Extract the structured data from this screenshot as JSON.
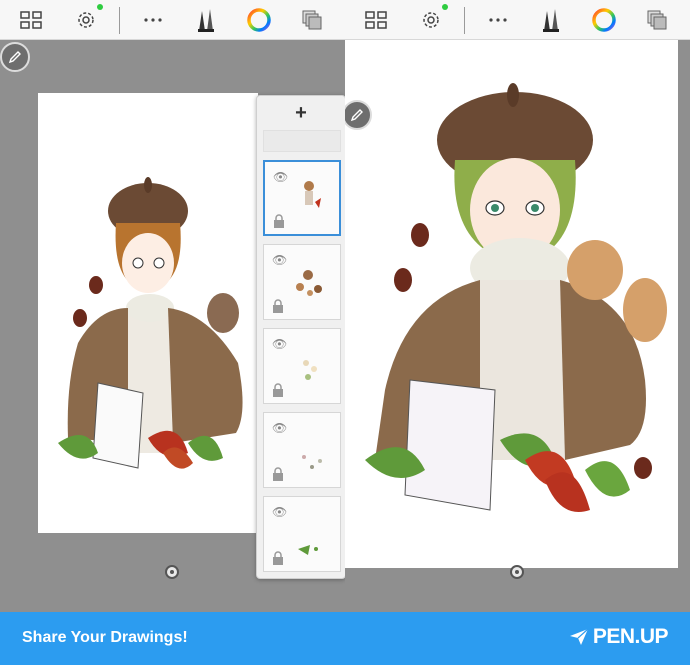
{
  "toolbar": {
    "icons": [
      "gallery-icon",
      "settings-icon",
      "more-icon",
      "pen-tools-icon",
      "color-wheel-icon",
      "layers-icon"
    ],
    "settings_badge_color": "#2ecc40"
  },
  "layers_panel": {
    "add_label": "+",
    "layer_count": 5,
    "selected_index": 0
  },
  "footer": {
    "text": "Share Your Drawings!",
    "logo": "PEN.UP",
    "background": "#2c9cf0"
  },
  "colors": {
    "canvas_bg": "#ffffff",
    "workspace_bg": "#8f8f8f",
    "selection_border": "#3b8fd9"
  }
}
